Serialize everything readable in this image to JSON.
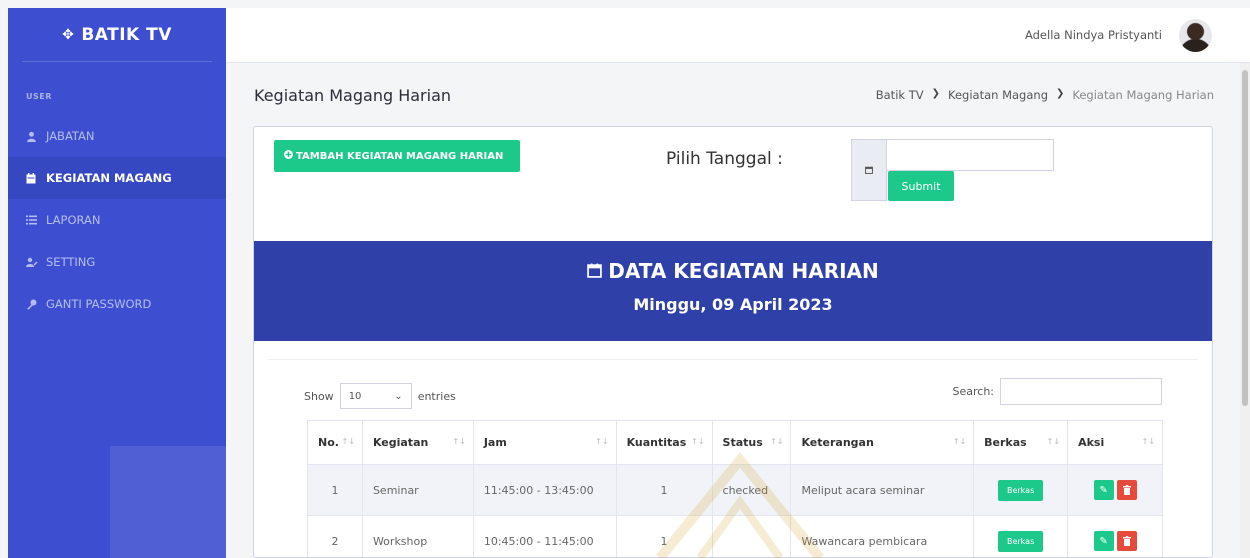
{
  "sidebar": {
    "brand": "BATIK TV",
    "brand_icon": "crosshair-icon",
    "section": "USER",
    "items": [
      {
        "label": "JABATAN",
        "icon": "user-icon",
        "active": false
      },
      {
        "label": "KEGIATAN MAGANG",
        "icon": "calendar-icon",
        "active": true
      },
      {
        "label": "LAPORAN",
        "icon": "list-icon",
        "active": false
      },
      {
        "label": "SETTING",
        "icon": "user-cog-icon",
        "active": false
      },
      {
        "label": "GANTI PASSWORD",
        "icon": "key-icon",
        "active": false
      }
    ]
  },
  "topbar": {
    "user_name": "Adella Nindya Pristyanti"
  },
  "header": {
    "title": "Kegiatan Magang Harian",
    "breadcrumb": [
      "Batik TV",
      "Kegiatan Magang",
      "Kegiatan Magang Harian"
    ]
  },
  "form": {
    "add_button": "TAMBAH KEGIATAN MAGANG HARIAN",
    "pilih_label": "Pilih Tanggal :",
    "date_value": "",
    "submit_label": "Submit"
  },
  "banner": {
    "title": "DATA KEGIATAN HARIAN",
    "date": "Minggu, 09 April 2023"
  },
  "table": {
    "show_label": "Show",
    "entries_value": "10",
    "entries_label": "entries",
    "search_label": "Search:",
    "search_value": "",
    "columns": [
      "No.",
      "Kegiatan",
      "Jam",
      "Kuantitas",
      "Status",
      "Keterangan",
      "Berkas",
      "Aksi"
    ],
    "rows": [
      {
        "no": "1",
        "kegiatan": "Seminar",
        "jam": "11:45:00 - 13:45:00",
        "kuantitas": "1",
        "status": "checked",
        "keterangan": "Meliput acara seminar",
        "berkas": "Berkas"
      },
      {
        "no": "2",
        "kegiatan": "Workshop",
        "jam": "10:45:00 - 11:45:00",
        "kuantitas": "1",
        "status": "",
        "keterangan": "Wawancara pembicara",
        "berkas": "Berkas"
      }
    ]
  },
  "colors": {
    "sidebar": "#3d4fd0",
    "banner": "#2f40a8",
    "success": "#1cc88a",
    "danger": "#e74a3b"
  }
}
